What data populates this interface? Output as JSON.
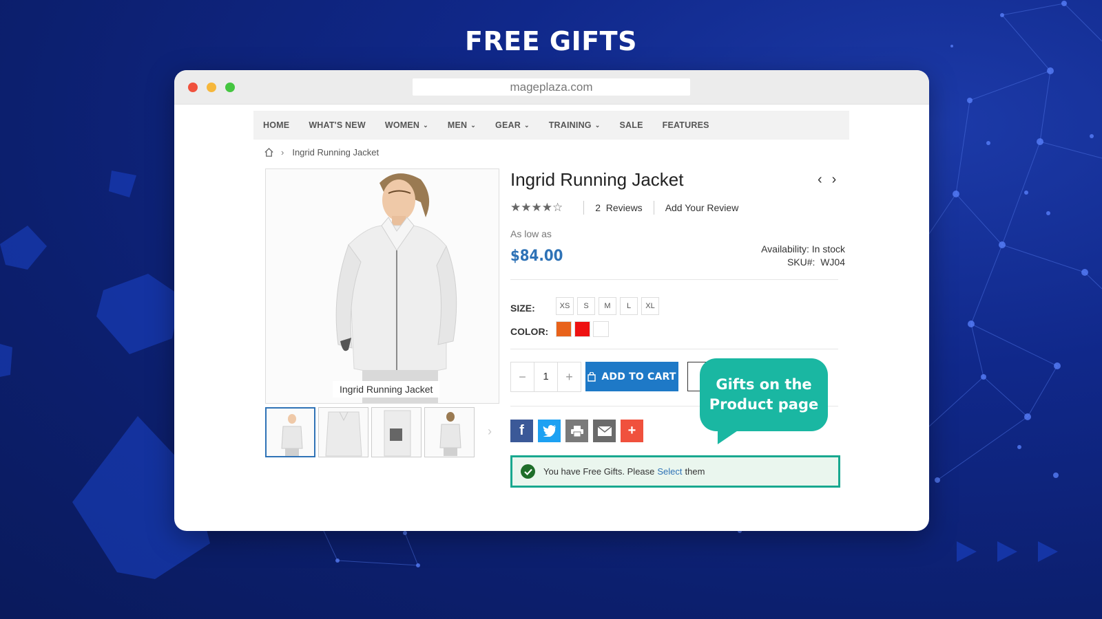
{
  "heading": "FREE GIFTS",
  "browser": {
    "address": "mageplaza.com"
  },
  "nav": {
    "items": [
      {
        "label": "HOME",
        "dropdown": false
      },
      {
        "label": "WHAT'S NEW",
        "dropdown": false
      },
      {
        "label": "WOMEN",
        "dropdown": true
      },
      {
        "label": "MEN",
        "dropdown": true
      },
      {
        "label": "GEAR",
        "dropdown": true
      },
      {
        "label": "TRAINING",
        "dropdown": true
      },
      {
        "label": "SALE",
        "dropdown": false
      },
      {
        "label": "FEATURES",
        "dropdown": false
      }
    ]
  },
  "breadcrumb": {
    "current": "Ingrid Running Jacket"
  },
  "gallery": {
    "caption": "Ingrid Running Jacket",
    "thumbnail_count": 4
  },
  "product": {
    "title": "Ingrid Running Jacket",
    "rating_stars": 4.5,
    "reviews_count": "2",
    "reviews_label": "Reviews",
    "add_review": "Add Your Review",
    "as_low_as": "As low as",
    "price": "$84.00",
    "availability": "Availability: In stock",
    "sku_label": "SKU#:",
    "sku": "WJ04",
    "size_label": "SIZE:",
    "sizes": [
      "XS",
      "S",
      "M",
      "L",
      "XL"
    ],
    "color_label": "COLOR:",
    "colors": [
      "#e8621a",
      "#ee1111",
      "#ffffff"
    ],
    "qty": "1",
    "add_to_cart": "ADD TO CART"
  },
  "social": {
    "icons": [
      "facebook-icon",
      "twitter-icon",
      "print-icon",
      "email-icon",
      "share-plus-icon"
    ],
    "colors": [
      "#3b5998",
      "#1da1f2",
      "#7a7a7a",
      "#6b6b6b",
      "#f0513d"
    ]
  },
  "free_gift": {
    "text_before": "You have Free Gifts. Please",
    "link": "Select",
    "text_after": "them"
  },
  "callout": {
    "line1": "Gifts on the",
    "line2": "Product page"
  },
  "colors": {
    "accent": "#1e79c7",
    "teal": "#1ab7a2",
    "background": "#10288a"
  }
}
